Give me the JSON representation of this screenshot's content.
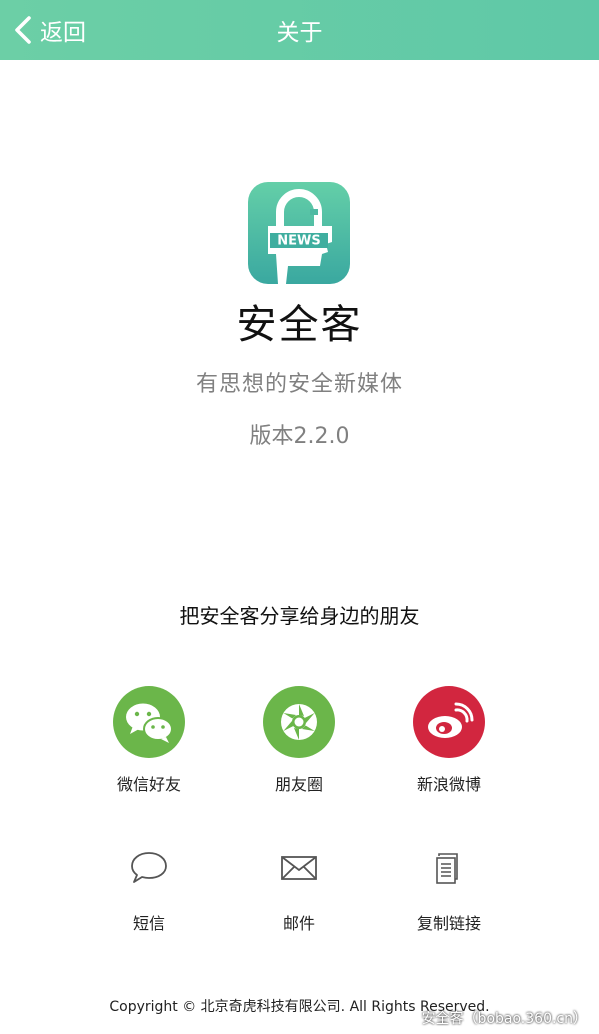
{
  "navbar": {
    "back_label": "返回",
    "title": "关于",
    "background": "#62cba6"
  },
  "app": {
    "icon_text": "NEWS",
    "name": "安全客",
    "tagline": "有思想的安全新媒体",
    "version": "版本2.2.0"
  },
  "share": {
    "heading": "把安全客分享给身边的朋友",
    "primary": [
      {
        "label": "微信好友",
        "icon": "wechat-icon",
        "color": "#6bb64a"
      },
      {
        "label": "朋友圈",
        "icon": "moments-icon",
        "color": "#6bb64a"
      },
      {
        "label": "新浪微博",
        "icon": "weibo-icon",
        "color": "#d2263f"
      }
    ],
    "secondary": [
      {
        "label": "短信",
        "icon": "sms-icon"
      },
      {
        "label": "邮件",
        "icon": "mail-icon"
      },
      {
        "label": "复制链接",
        "icon": "copy-link-icon"
      }
    ]
  },
  "footer": {
    "copyright": "Copyright © 北京奇虎科技有限公司. All Rights Reserved."
  },
  "watermark": "安全客（bobao.360.cn）"
}
